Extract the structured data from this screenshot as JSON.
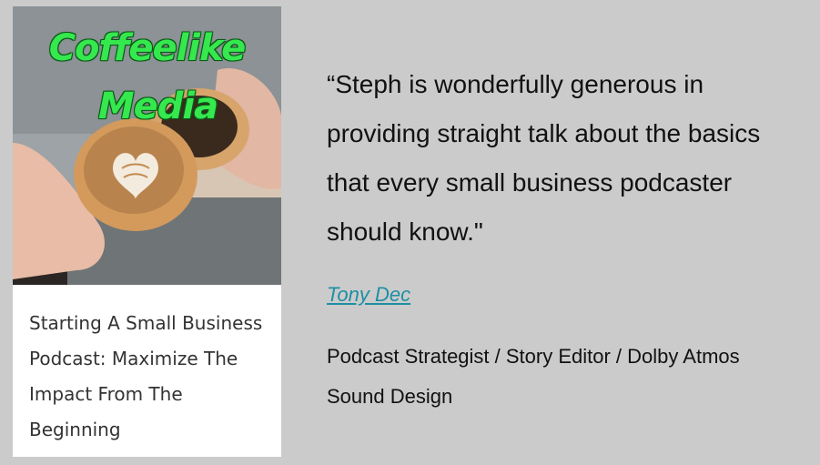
{
  "podcast": {
    "cover_title_line1": "Coffeelike",
    "cover_title_line2": "Media",
    "episode_title": "Starting A Small Business Podcast: Maximize The Impact From The Beginning"
  },
  "testimonial": {
    "quote": "“Steph is wonderfully generous in providing straight talk about the basics that every small business podcaster should know.\"",
    "author_name": "Tony Dec",
    "author_role": "Podcast Strategist / Story Editor / Dolby Atmos Sound Design"
  },
  "colors": {
    "background": "#cbcbcb",
    "link": "#1d8fa4",
    "cover_title": "#35e84e"
  }
}
